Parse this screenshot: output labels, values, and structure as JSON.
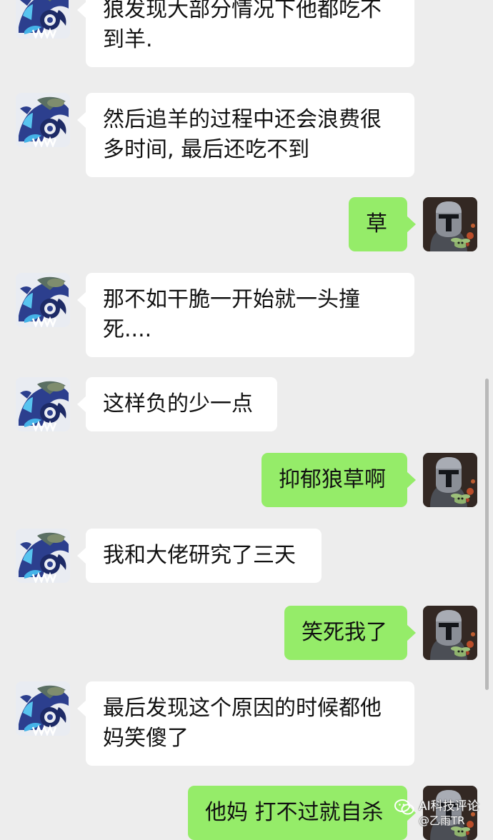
{
  "chat": {
    "messages": [
      {
        "side": "left",
        "avatar": "monster-avatar-icon",
        "text": "狼发现大部分情况下他都吃不到羊."
      },
      {
        "side": "left",
        "avatar": "monster-avatar-icon",
        "text": "然后追羊的过程中还会浪费很多时间, 最后还吃不到"
      },
      {
        "side": "right",
        "avatar": "armored-hero-avatar-icon",
        "text": "草"
      },
      {
        "side": "left",
        "avatar": "monster-avatar-icon",
        "text": "那不如干脆一开始就一头撞死...."
      },
      {
        "side": "left",
        "avatar": "monster-avatar-icon",
        "text": "这样负的少一点"
      },
      {
        "side": "right",
        "avatar": "armored-hero-avatar-icon",
        "text": "抑郁狼草啊"
      },
      {
        "side": "left",
        "avatar": "monster-avatar-icon",
        "text": "我和大佬研究了三天"
      },
      {
        "side": "right",
        "avatar": "armored-hero-avatar-icon",
        "text": "笑死我了"
      },
      {
        "side": "left",
        "avatar": "monster-avatar-icon",
        "text": "最后发现这个原因的时候都他妈笑傻了"
      },
      {
        "side": "right",
        "avatar": "armored-hero-avatar-icon",
        "text": "他妈 打不过就自杀"
      }
    ]
  },
  "watermark": {
    "brand": "AI科技评论",
    "handle": "@乙雨TR",
    "icon": "wechat-icon"
  },
  "colors": {
    "background": "#ededed",
    "incoming_bubble": "#ffffff",
    "outgoing_bubble": "#95ec69",
    "text": "#111111"
  }
}
